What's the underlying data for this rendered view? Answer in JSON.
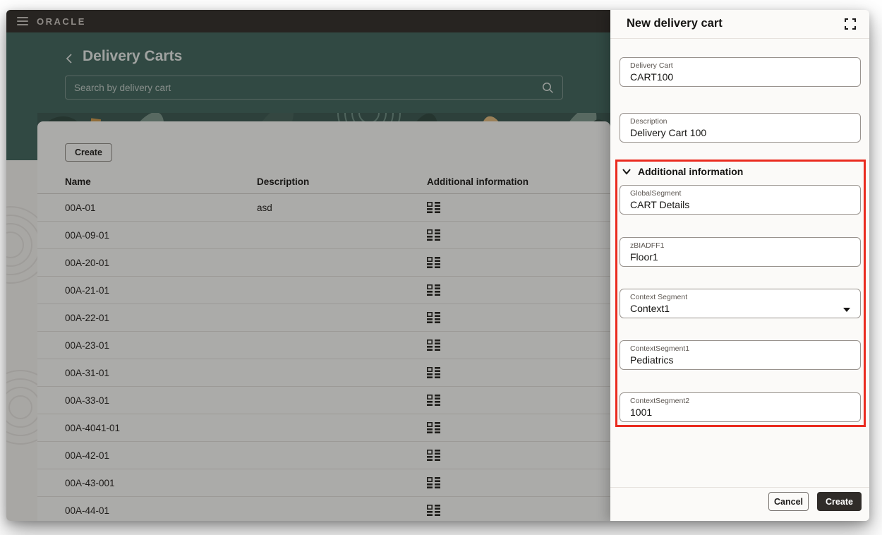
{
  "topbar": {
    "brand": "ORACLE"
  },
  "header": {
    "title": "Delivery Carts",
    "search_placeholder": "Search by delivery cart"
  },
  "table": {
    "create_label": "Create",
    "columns": [
      "Name",
      "Description",
      "Additional information"
    ],
    "rows": [
      {
        "name": "00A-01",
        "description": "asd"
      },
      {
        "name": "00A-09-01",
        "description": ""
      },
      {
        "name": "00A-20-01",
        "description": ""
      },
      {
        "name": "00A-21-01",
        "description": ""
      },
      {
        "name": "00A-22-01",
        "description": ""
      },
      {
        "name": "00A-23-01",
        "description": ""
      },
      {
        "name": "00A-31-01",
        "description": ""
      },
      {
        "name": "00A-33-01",
        "description": ""
      },
      {
        "name": "00A-4041-01",
        "description": ""
      },
      {
        "name": "00A-42-01",
        "description": ""
      },
      {
        "name": "00A-43-001",
        "description": ""
      },
      {
        "name": "00A-44-01",
        "description": ""
      }
    ]
  },
  "panel": {
    "title": "New delivery cart",
    "fields": [
      {
        "label": "Delivery Cart",
        "value": "CART100"
      },
      {
        "label": "Description",
        "value": "Delivery Cart 100"
      }
    ],
    "section": {
      "title": "Additional information",
      "fields": [
        {
          "label": "GlobalSegment",
          "value": "CART Details",
          "type": "text"
        },
        {
          "label": "zBIADFF1",
          "value": "Floor1",
          "type": "text"
        },
        {
          "label": "Context Segment",
          "value": "Context1",
          "type": "select"
        },
        {
          "label": "ContextSegment1",
          "value": "Pediatrics",
          "type": "text"
        },
        {
          "label": "ContextSegment2",
          "value": "1001",
          "type": "text"
        }
      ]
    },
    "footer": {
      "cancel_label": "Cancel",
      "create_label": "Create"
    }
  },
  "icons": {
    "menu": "hamburger",
    "back": "chevron-left",
    "search": "magnifier",
    "additional_info": "flexfield-grid",
    "expand": "fullscreen-corners",
    "section": "chevron-down",
    "select": "caret-down"
  },
  "colors": {
    "annotation_red": "#ea2b1f",
    "header_teal": "#40655d",
    "topbar_dark": "#312d2a",
    "primary_button_dark": "#302c29",
    "panel_background": "#fbfaf8"
  }
}
